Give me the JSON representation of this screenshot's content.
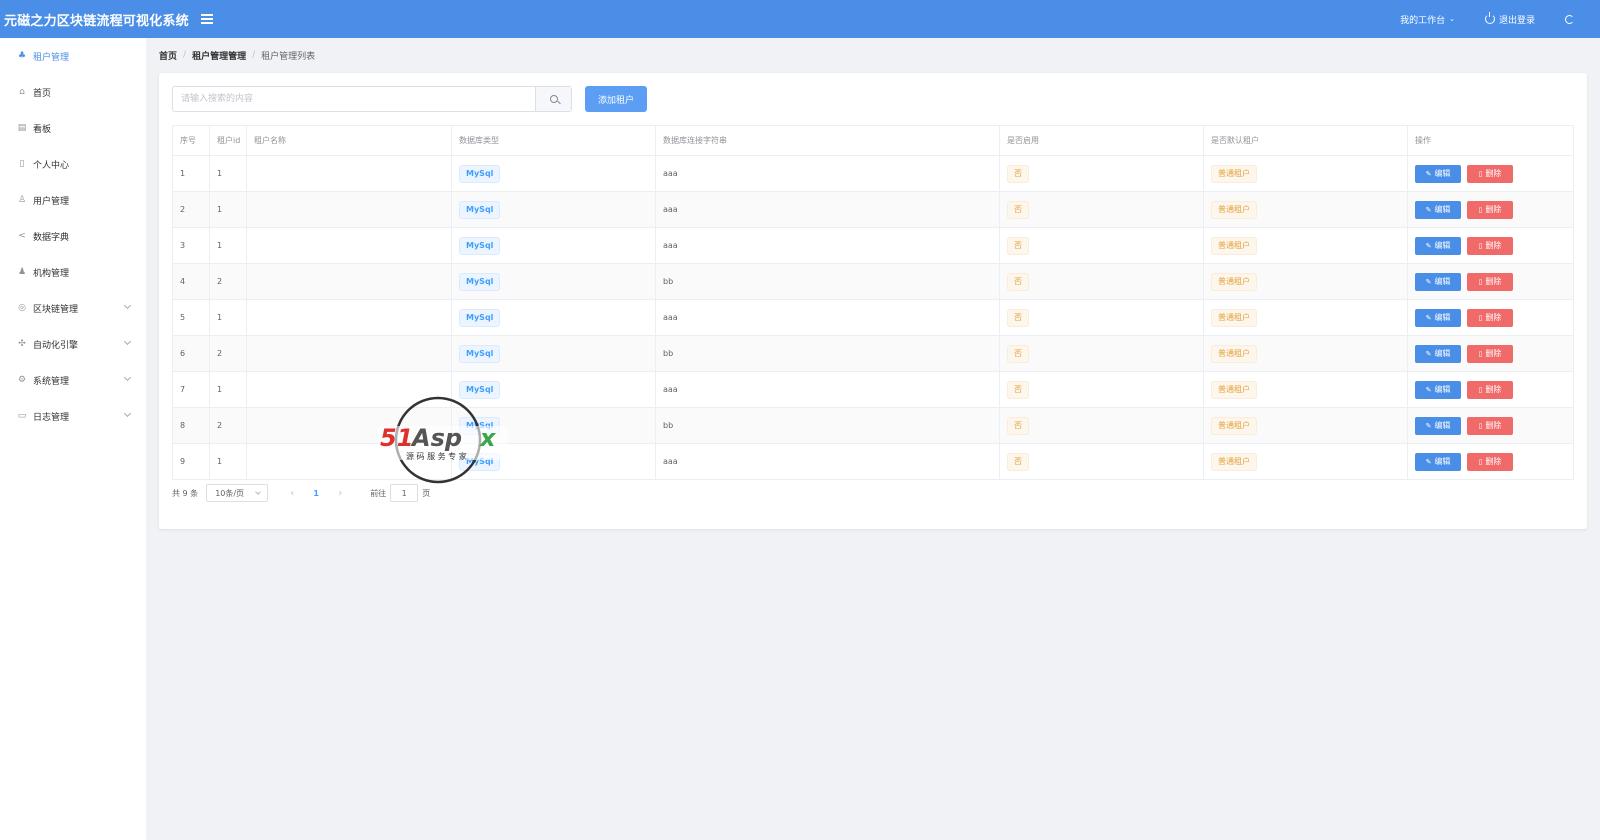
{
  "header": {
    "app_title": "元磁之力区块链流程可视化系统",
    "workbench_label": "我的工作台",
    "logout_label": "退出登录",
    "accent_color": "#4a8ee8"
  },
  "sidebar": {
    "items": [
      {
        "label": "租户管理",
        "icon": "tenant-icon",
        "active": true
      },
      {
        "label": "首页",
        "icon": "home-icon"
      },
      {
        "label": "看板",
        "icon": "dashboard-icon"
      },
      {
        "label": "个人中心",
        "icon": "profile-icon"
      },
      {
        "label": "用户管理",
        "icon": "user-icon"
      },
      {
        "label": "数据字典",
        "icon": "share-icon"
      },
      {
        "label": "机构管理",
        "icon": "org-icon"
      },
      {
        "label": "区块链管理",
        "icon": "eye-icon",
        "expandable": true
      },
      {
        "label": "自动化引擎",
        "icon": "engine-icon",
        "expandable": true
      },
      {
        "label": "系统管理",
        "icon": "gear-icon",
        "expandable": true
      },
      {
        "label": "日志管理",
        "icon": "log-icon",
        "expandable": true
      }
    ]
  },
  "breadcrumb": [
    "首页",
    "租户管理管理",
    "租户管理列表"
  ],
  "search": {
    "placeholder": "请输入搜索的内容",
    "value": ""
  },
  "add_button_label": "添加租户",
  "table": {
    "columns": [
      "序号",
      "租户id",
      "租户名称",
      "数据库类型",
      "数据库连接字符串",
      "是否启用",
      "是否默认租户",
      "操作"
    ],
    "edit_label": "编辑",
    "delete_label": "删除",
    "rows": [
      {
        "index": "1",
        "tenant_id": "1",
        "name": "",
        "db_type": "MySql",
        "conn": "aaa",
        "enabled": "否",
        "default_tenant": "普通租户"
      },
      {
        "index": "2",
        "tenant_id": "1",
        "name": "",
        "db_type": "MySql",
        "conn": "aaa",
        "enabled": "否",
        "default_tenant": "普通租户"
      },
      {
        "index": "3",
        "tenant_id": "1",
        "name": "",
        "db_type": "MySql",
        "conn": "aaa",
        "enabled": "否",
        "default_tenant": "普通租户"
      },
      {
        "index": "4",
        "tenant_id": "2",
        "name": "",
        "db_type": "MySql",
        "conn": "bb",
        "enabled": "否",
        "default_tenant": "普通租户"
      },
      {
        "index": "5",
        "tenant_id": "1",
        "name": "",
        "db_type": "MySql",
        "conn": "aaa",
        "enabled": "否",
        "default_tenant": "普通租户"
      },
      {
        "index": "6",
        "tenant_id": "2",
        "name": "",
        "db_type": "MySql",
        "conn": "bb",
        "enabled": "否",
        "default_tenant": "普通租户"
      },
      {
        "index": "7",
        "tenant_id": "1",
        "name": "",
        "db_type": "MySql",
        "conn": "aaa",
        "enabled": "否",
        "default_tenant": "普通租户"
      },
      {
        "index": "8",
        "tenant_id": "2",
        "name": "",
        "db_type": "MySql",
        "conn": "bb",
        "enabled": "否",
        "default_tenant": "普通租户"
      },
      {
        "index": "9",
        "tenant_id": "1",
        "name": "",
        "db_type": "MySql",
        "conn": "aaa",
        "enabled": "否",
        "default_tenant": "普通租户"
      }
    ]
  },
  "pagination": {
    "total_label": "共 9 条",
    "page_size": "10条/页",
    "current_page": "1",
    "goto_label": "前往",
    "goto_value": "1",
    "page_suffix": "页"
  },
  "watermark": {
    "brand": "51Aspx",
    "tagline": "源 码 服 务 专 家"
  }
}
